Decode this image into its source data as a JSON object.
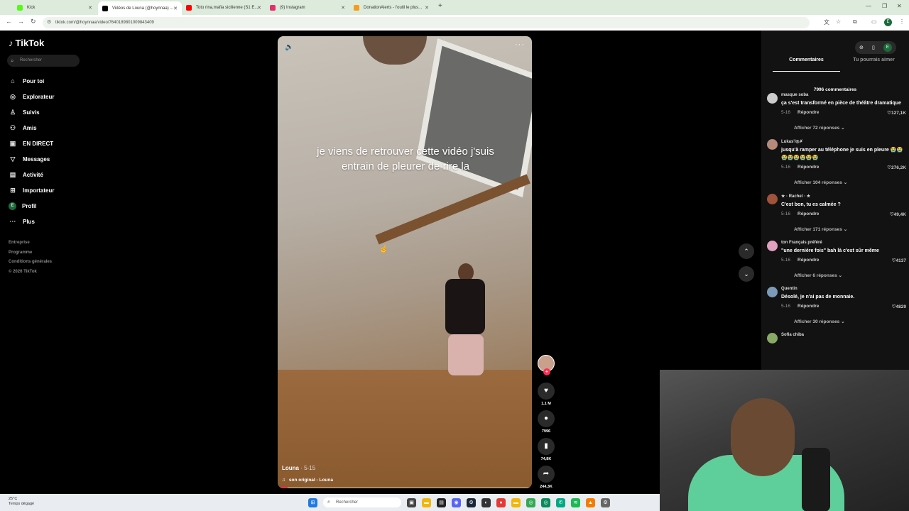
{
  "browser": {
    "tabs": [
      {
        "title": "Kick",
        "color": "#53fc18"
      },
      {
        "title": "Vidéos de Louna (@hoynnaa) ...",
        "color": "#000000"
      },
      {
        "title": "Toto rina,mafia sicilienne (S1 E...",
        "color": "#ff0000"
      },
      {
        "title": "(9) Instagram",
        "color": "#e1306c"
      },
      {
        "title": "DonationAlerts - l'outil le plus...",
        "color": "#f59c1a"
      }
    ],
    "url": "tiktok.com/@hoynnaa/video/7640189801009843409",
    "profile_initial": "E"
  },
  "tiktok": {
    "logo": "TikTok",
    "search_placeholder": "Rechercher",
    "menu": [
      {
        "label": "Pour toi",
        "icon": "home-icon"
      },
      {
        "label": "Explorateur",
        "icon": "compass-icon"
      },
      {
        "label": "Suivis",
        "icon": "following-icon"
      },
      {
        "label": "Amis",
        "icon": "friends-icon"
      },
      {
        "label": "EN DIRECT",
        "icon": "live-icon"
      },
      {
        "label": "Messages",
        "icon": "messages-icon"
      },
      {
        "label": "Activité",
        "icon": "activity-icon"
      },
      {
        "label": "Importateur",
        "icon": "upload-icon"
      },
      {
        "label": "Profil",
        "icon": "profile-icon"
      },
      {
        "label": "Plus",
        "icon": "more-icon"
      }
    ],
    "footer_links": [
      "Entreprise",
      "Programme",
      "Conditions générales",
      "© 2026 TikTok"
    ],
    "video": {
      "caption": "je viens de retrouver cette vidéo j'suis entrain de pleurer de rire la",
      "author": "Louna",
      "date": "5-15",
      "sound": "son original - Louna",
      "progress": 0.04
    },
    "actions": {
      "likes": "1,1 M",
      "comments": "7996",
      "saves": "74,8K",
      "shares": "244,3K"
    },
    "panel": {
      "tab_comments": "Commentaires",
      "tab_suggested": "Tu pourrais aimer",
      "comment_count": "7996 commentaires",
      "comments": [
        {
          "user": "masque soba",
          "text": "ça s'est transformé en pièce de théâtre dramatique",
          "date": "5-16",
          "reply": "Répondre",
          "likes": "127,1K",
          "more": "Afficher 72 réponses",
          "avatar_color": "#cccccc"
        },
        {
          "user": "Lukas'/◎✗",
          "text": "jusqu'à ramper au téléphone je suis en pleure 😭😭😭😭😭😭😭😭",
          "date": "5-16",
          "reply": "Répondre",
          "likes": "276,2K",
          "more": "Afficher 104 réponses",
          "avatar_color": "#b58a7a"
        },
        {
          "user": "★ · Rachel · ★",
          "text": "C'est bon, tu es calmée ?",
          "date": "5-16",
          "reply": "Répondre",
          "likes": "49,4K",
          "more": "Afficher 171 réponses",
          "avatar_color": "#a0523a"
        },
        {
          "user": "ton Français préféré",
          "text": "\"une dernière fois\" bah là c'est sûr même",
          "date": "5-16",
          "reply": "Répondre",
          "likes": "4137",
          "more": "Afficher 6 réponses",
          "avatar_color": "#e0a0c0"
        },
        {
          "user": "Quentin",
          "text": "Désolé, je n'ai pas de monnaie.",
          "date": "5-16",
          "reply": "Répondre",
          "likes": "4829",
          "more": "Afficher 30 réponses",
          "avatar_color": "#7a9ab8"
        },
        {
          "user": "Sofia chiba",
          "text": "",
          "date": "",
          "reply": "",
          "likes": "",
          "more": "",
          "avatar_color": "#88aa66"
        }
      ]
    }
  },
  "taskbar": {
    "weather_temp": "25°C",
    "weather_desc": "Temps dégagé",
    "search_placeholder": "Rechercher"
  }
}
